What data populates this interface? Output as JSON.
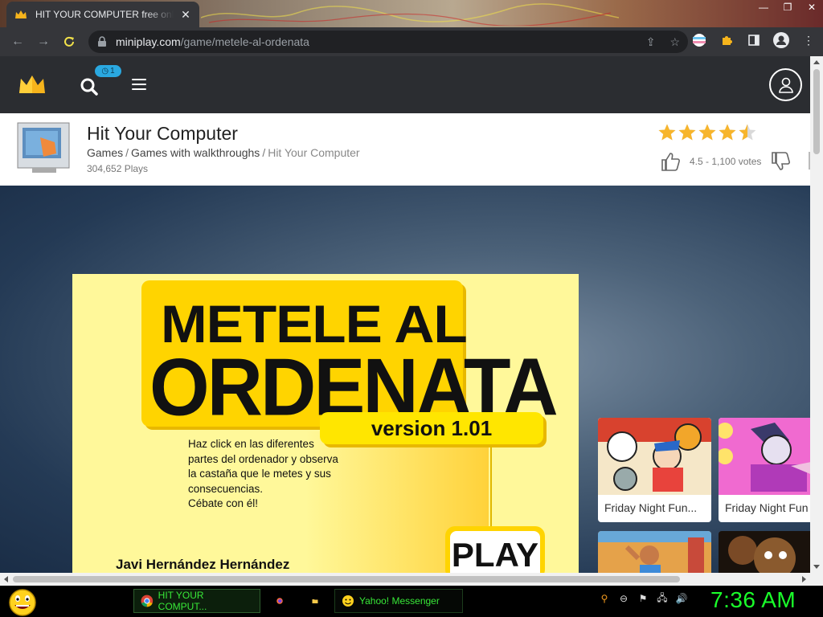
{
  "browser": {
    "tab_title": "HIT YOUR COMPUTER free online",
    "url_host": "miniplay.com",
    "url_path": "/game/metele-al-ordenata"
  },
  "site": {
    "notification_badge": "1"
  },
  "game": {
    "title": "Hit Your Computer",
    "breadcrumb": [
      "Games",
      "Games with walkthroughs",
      "Hit Your Computer"
    ],
    "breadcrumb_sep": "/",
    "plays": "304,652 Plays",
    "rating": 4.5,
    "rating_text": "4.5 - 1,100 votes"
  },
  "game_frame": {
    "title_line1": "METELE AL",
    "title_line2": "ORDENATA",
    "version": "version 1.01",
    "description": [
      "Haz click en las diferentes",
      "partes del ordenador y observa",
      "la castaña que le metes y sus",
      "consecuencias.",
      "Cébate con él!"
    ],
    "play_label": "PLAY",
    "author": "Javi Hernández Hernández"
  },
  "related_games": [
    {
      "label": "Friday Night Fun..."
    },
    {
      "label": "Friday Night Fun"
    }
  ],
  "taskbar": {
    "items": [
      {
        "label": "HIT YOUR COMPUT..."
      },
      {
        "label": "Yahoo! Messenger"
      }
    ],
    "clock": "7:36 AM"
  },
  "colors": {
    "site_header": "#2b2d31",
    "accent_badge": "#2aa8e0",
    "star": "#f7b52c",
    "clock_green": "#1aff2a",
    "game_yellow": "#ffd400"
  }
}
